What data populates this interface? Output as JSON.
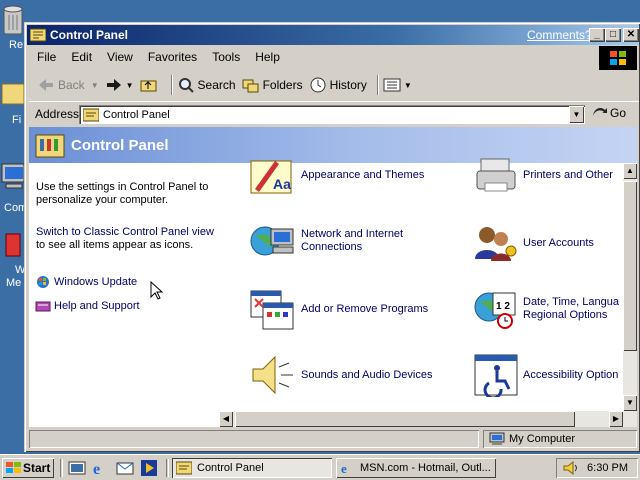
{
  "desktop": {
    "labels": [
      "Re",
      "Fi",
      "Com",
      "W",
      "Me"
    ]
  },
  "window": {
    "title": "Control Panel",
    "comments_link": "Comments?",
    "menu": [
      "File",
      "Edit",
      "View",
      "Favorites",
      "Tools",
      "Help"
    ],
    "toolbar": {
      "back": "Back",
      "search": "Search",
      "folders": "Folders",
      "history": "History"
    },
    "address": {
      "label": "Address",
      "value": "Control Panel",
      "go": "Go"
    },
    "banner_title": "Control Panel",
    "left_pane": {
      "intro": "Use the settings in Control Panel to personalize your computer.",
      "switch_link": "Switch to Classic Control Panel view",
      "switch_rest": "to see all items appear as icons.",
      "links": [
        "Windows Update",
        "Help and Support"
      ]
    },
    "categories": [
      {
        "label": "Appearance and Themes",
        "icon": "appearance-icon"
      },
      {
        "label": "Printers and Other",
        "icon": "printer-icon"
      },
      {
        "label": "Network and Internet Connections",
        "icon": "network-icon"
      },
      {
        "label": "User Accounts",
        "icon": "user-accounts-icon"
      },
      {
        "label": "Add or Remove Programs",
        "icon": "add-remove-icon"
      },
      {
        "label": "Date, Time, Langua Regional Options",
        "icon": "date-time-icon"
      },
      {
        "label": "Sounds and Audio Devices",
        "icon": "speaker-icon"
      },
      {
        "label": "Accessibility Option",
        "icon": "accessibility-icon"
      }
    ],
    "status_zone": "My Computer"
  },
  "taskbar": {
    "start": "Start",
    "tasks": [
      "Control Panel",
      "MSN.com - Hotmail, Outl..."
    ],
    "clock": "6:30 PM"
  },
  "colors": {
    "desktop": "#3a6ea5",
    "title_active": "#0a246a",
    "banner": "#7b9ee0",
    "link": "#000066"
  }
}
